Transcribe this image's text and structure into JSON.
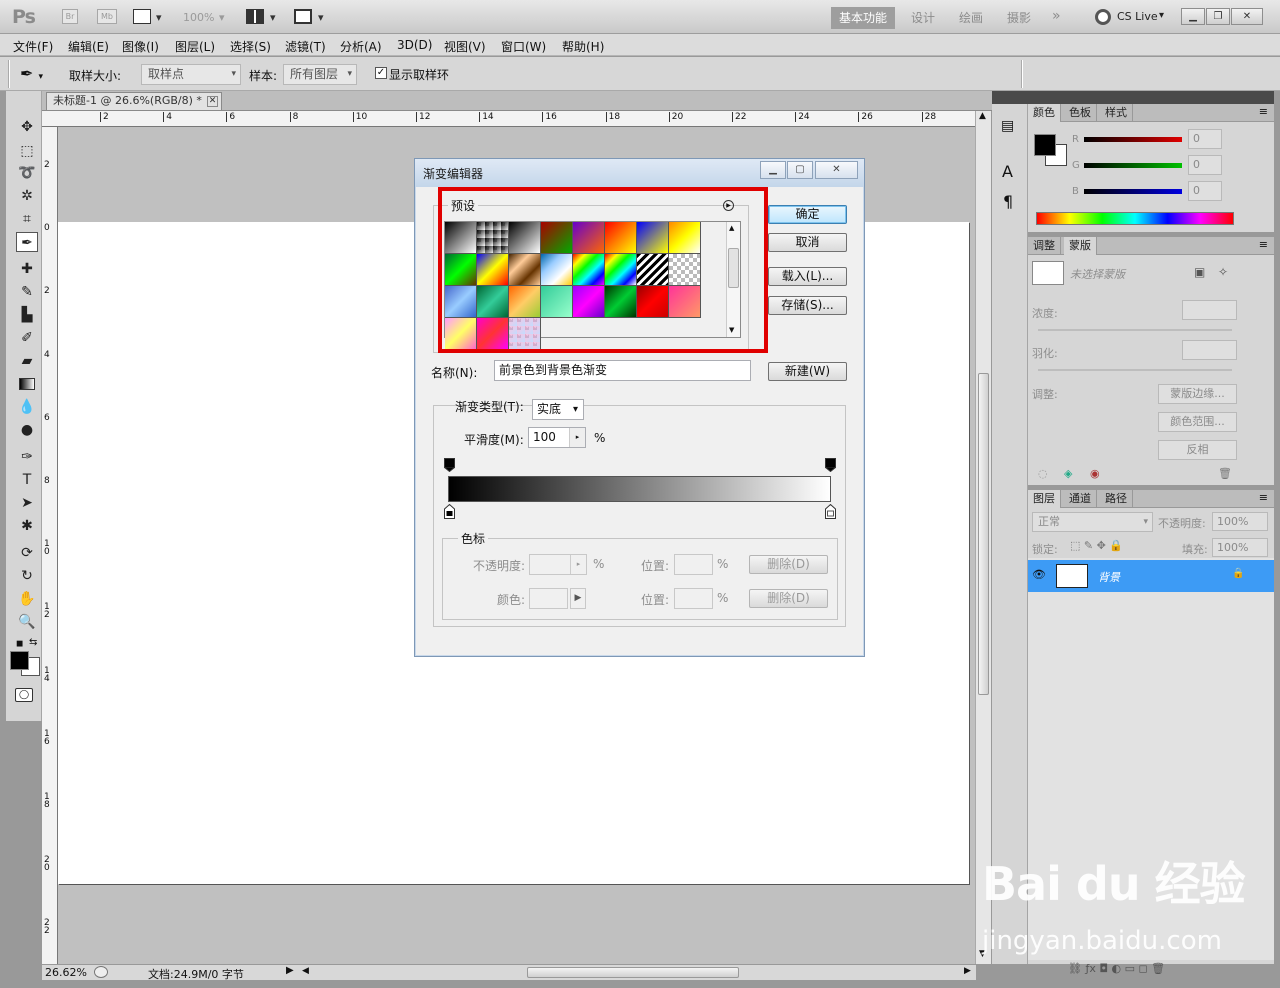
{
  "app": {
    "logo": "Ps",
    "bridge": "Br",
    "mini_bridge": "Mb",
    "zoom_dd": "100%",
    "workspaces": [
      "基本功能",
      "设计",
      "绘画",
      "摄影"
    ],
    "more": "»",
    "cslive": "CS Live"
  },
  "menu": [
    "文件(F)",
    "编辑(E)",
    "图像(I)",
    "图层(L)",
    "选择(S)",
    "滤镜(T)",
    "分析(A)",
    "3D(D)",
    "视图(V)",
    "窗口(W)",
    "帮助(H)"
  ],
  "options": {
    "size_label": "取样大小:",
    "size_value": "取样点",
    "sample_label": "样本:",
    "sample_value": "所有图层",
    "ring_label": "显示取样环",
    "ring_checked": true
  },
  "document": {
    "tab_title": "未标题-1 @ 26.6%(RGB/8) *",
    "ruler_h": [
      "2",
      "4",
      "6",
      "8",
      "10",
      "12",
      "14",
      "16",
      "18",
      "20",
      "22",
      "24",
      "26",
      "28"
    ],
    "ruler_v": [
      "2",
      "0",
      "2",
      "4",
      "6",
      "8",
      "10",
      "12",
      "14",
      "16",
      "18",
      "20",
      "22"
    ],
    "zoom": "26.62%",
    "doc_info": "文档:24.9M/0 字节"
  },
  "dialog": {
    "title": "渐变编辑器",
    "presets_label": "预设",
    "ok": "确定",
    "cancel": "取消",
    "load": "载入(L)...",
    "save": "存储(S)...",
    "name_label": "名称(N):",
    "name_value": "前景色到背景色渐变",
    "new": "新建(W)",
    "type_label": "渐变类型(T):",
    "type_value": "实底",
    "smooth_label": "平滑度(M):",
    "smooth_value": "100",
    "percent": "%",
    "stops_label": "色标",
    "opacity_label": "不透明度:",
    "location_label": "位置:",
    "color_label": "颜色:",
    "delete": "删除(D)"
  },
  "panels": {
    "color_tabs": [
      "颜色",
      "色板",
      "样式"
    ],
    "channels": [
      "R",
      "G",
      "B"
    ],
    "channel_values": [
      "0",
      "0",
      "0"
    ],
    "masks_tabs": [
      "调整",
      "蒙版"
    ],
    "no_mask": "未选择蒙版",
    "density": "浓度:",
    "feather": "羽化:",
    "refine": "调整:",
    "mask_edge": "蒙版边缘...",
    "color_range": "颜色范围...",
    "invert": "反相",
    "layers_tabs": [
      "图层",
      "通道",
      "路径"
    ],
    "blend": "正常",
    "opacity_label": "不透明度:",
    "opacity_value": "100%",
    "lock_label": "锁定:",
    "fill_label": "填充:",
    "fill_value": "100%",
    "layer_name": "背景"
  },
  "watermark": {
    "brand": "Bai du 经验",
    "url": "jingyan.baidu.com"
  },
  "colors": {
    "highlight": "#e00000",
    "selected_layer": "#3d9bf5",
    "workspace_active": "#9e9e9e"
  }
}
